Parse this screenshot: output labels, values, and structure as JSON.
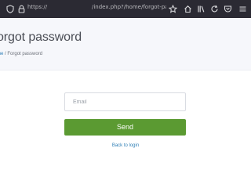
{
  "browser": {
    "url_scheme": "https://",
    "url_path": "/index.php?/home/forgot-passw",
    "icons": [
      "shield-icon",
      "lock-icon",
      "bookmark-star-icon",
      "home-icon",
      "library-icon",
      "sync-icon",
      "pocket-icon",
      "menu-icon"
    ]
  },
  "page": {
    "title": "orgot password",
    "breadcrumb": {
      "home": "me",
      "separator": " / ",
      "current": "Forgot password"
    }
  },
  "form": {
    "email_placeholder": "Email",
    "email_value": "",
    "send_label": "Send",
    "back_label": "Back to login"
  },
  "colors": {
    "toolbar_bg": "#2b2a33",
    "hero_bg": "#f6f7fb",
    "send_button": "#5b9a32",
    "link": "#2f7fb6"
  }
}
